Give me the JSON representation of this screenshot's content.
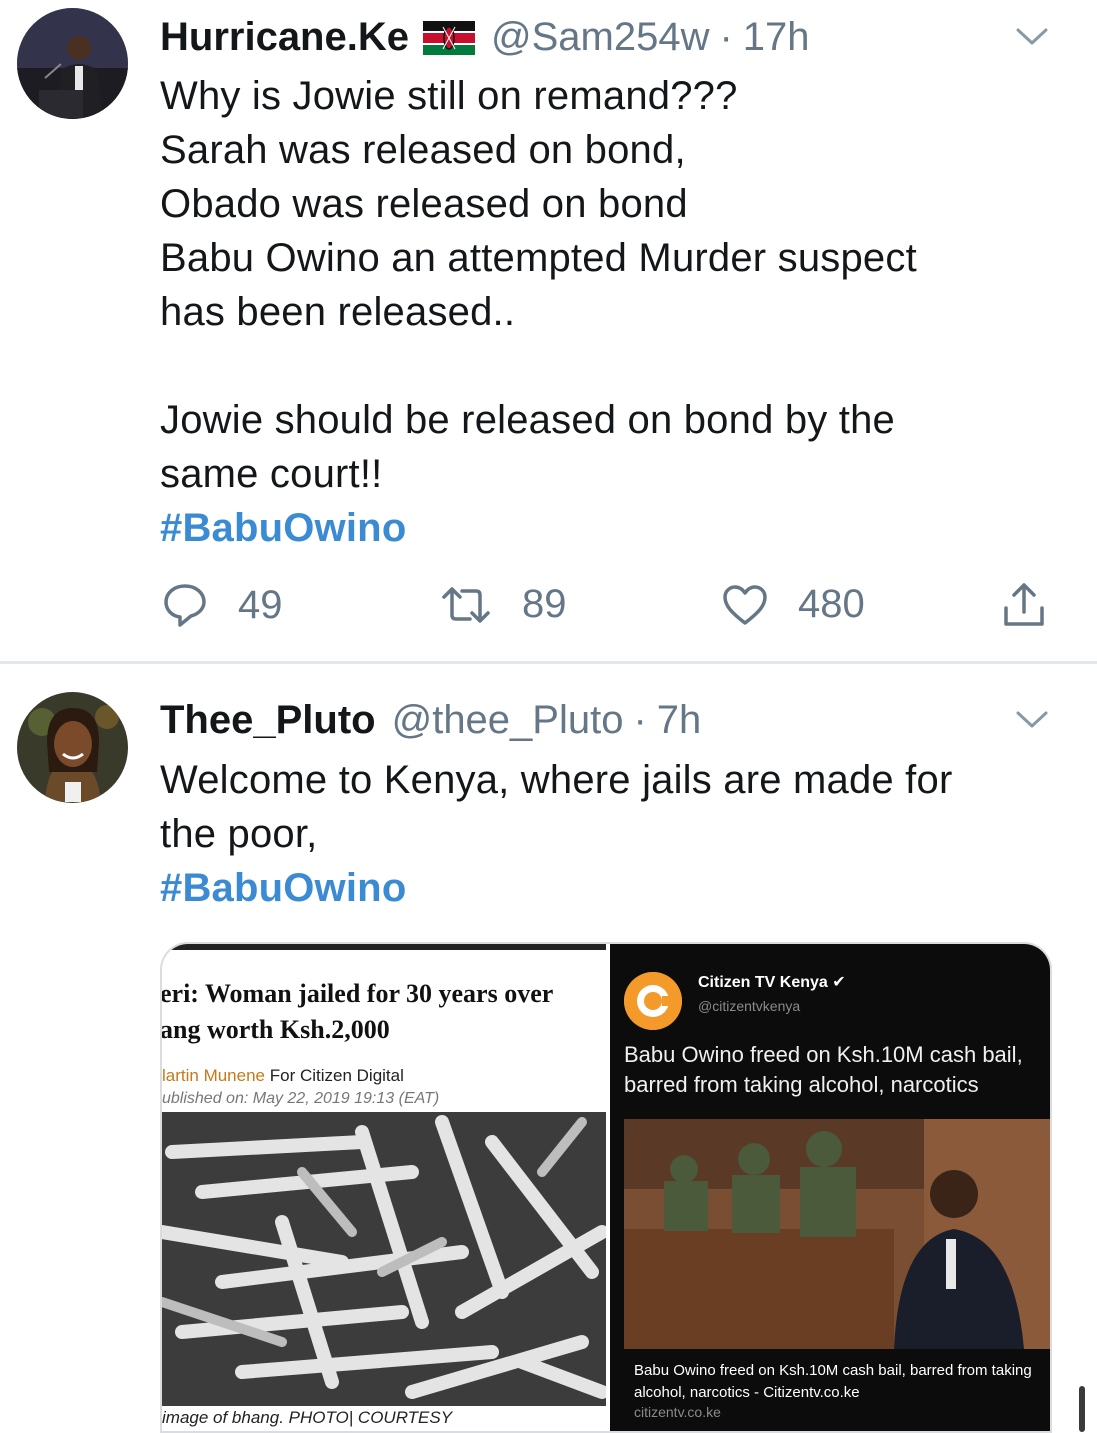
{
  "tweets": [
    {
      "display_name": "Hurricane.Ke",
      "flag_icon": "kenya-flag-icon",
      "handle": "@Sam254w",
      "separator": "·",
      "time": "17h",
      "lines": [
        "Why is Jowie still on remand???",
        "Sarah was released on bond,",
        "Obado was released on bond",
        "Babu Owino an attempted Murder suspect",
        "has been released..",
        "",
        "Jowie should be released on bond by the",
        "same court!!"
      ],
      "hashtag": "#BabuOwino",
      "actions": {
        "replies": "49",
        "retweets": "89",
        "likes": "480"
      }
    },
    {
      "display_name": "Thee_Pluto",
      "handle": "@thee_Pluto",
      "separator": "·",
      "time": "7h",
      "lines": [
        "Welcome to Kenya, where jails are made for",
        "the poor,"
      ],
      "hashtag": "#BabuOwino",
      "media": {
        "left": {
          "headline_line1": "eri: Woman jailed for 30 years over",
          "headline_line2": "ang worth Ksh.2,000",
          "byline_author": "lartin Munene",
          "byline_rest": " For Citizen Digital",
          "published": "ublished on:  May 22, 2019 19:13 (EAT)",
          "caption": "image of bhang. PHOTO| COURTESY"
        },
        "right": {
          "account_name": "Citizen TV Kenya",
          "account_handle": "@citizentvkenya",
          "post_text": "Babu Owino freed on Ksh.10M cash bail, barred from taking alcohol, narcotics",
          "link_title": "Babu Owino freed on Ksh.10M cash bail, barred from taking alcohol, narcotics - Citizentv.co.ke",
          "link_domain": "citizentv.co.ke"
        }
      }
    }
  ],
  "colors": {
    "hashtag": "#3b8bd4",
    "secondary_text": "#657786",
    "divider": "#e1e8ed"
  }
}
